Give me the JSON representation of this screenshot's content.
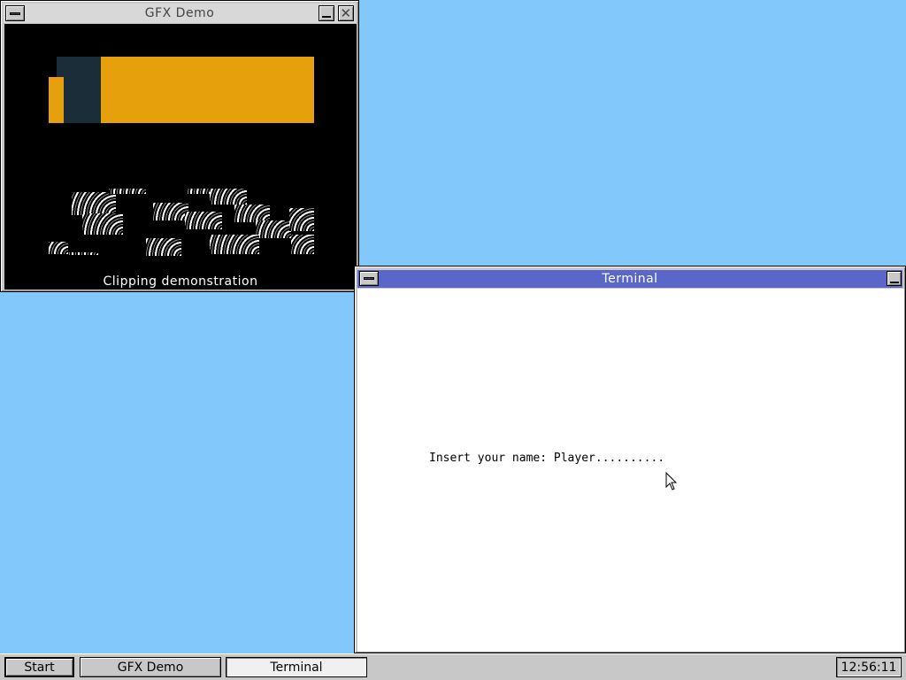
{
  "desktop": {
    "background_color": "#82c8fa"
  },
  "windows": {
    "gfx_demo": {
      "title": "GFX Demo",
      "caption": "Clipping demonstration",
      "title_text_color": "#444444",
      "canvas_color": "#000000",
      "accent_colors": {
        "orange": "#e6a00c",
        "dark_slate": "#1c2d3a"
      }
    },
    "terminal": {
      "title": "Terminal",
      "titlebar_color": "#5a66c8",
      "prompt": "Insert your name: ",
      "input_value": "Player.........."
    }
  },
  "icons": {
    "system_menu": "system-menu-icon",
    "minimize": "minimize-icon",
    "close": "close-icon",
    "cursor": "mouse-pointer-icon"
  },
  "taskbar": {
    "start_label": "Start",
    "tasks": [
      {
        "label": "GFX Demo"
      },
      {
        "label": "Terminal"
      }
    ],
    "clock": "12:56:11"
  }
}
